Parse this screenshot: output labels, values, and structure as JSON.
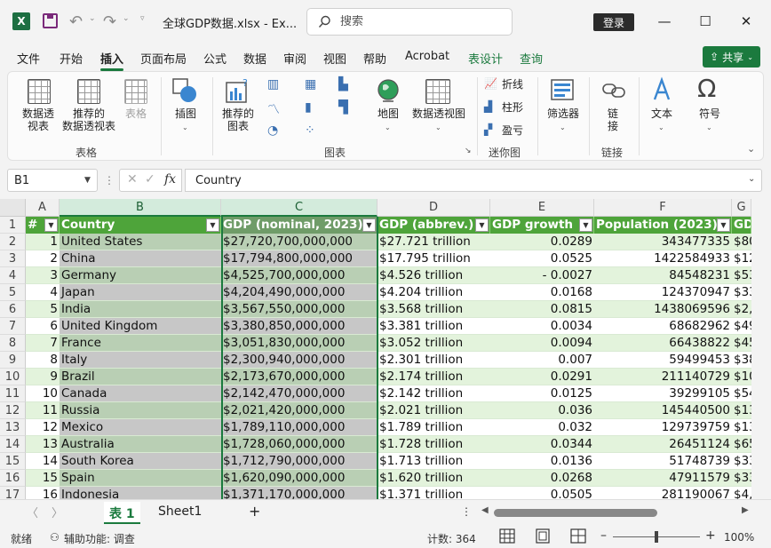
{
  "titlebar": {
    "app_icon": "X",
    "doc_title": "全球GDP数据.xlsx  -  Ex...",
    "search_placeholder": "搜索",
    "login_label": "登录"
  },
  "menu": {
    "tabs": [
      "文件",
      "开始",
      "插入",
      "页面布局",
      "公式",
      "数据",
      "审阅",
      "视图",
      "帮助",
      "Acrobat",
      "表设计",
      "查询"
    ],
    "active_tab": "插入",
    "share_label": "共享"
  },
  "ribbon": {
    "pivot_table": "数据透\n视表",
    "recommended_pivot": "推荐的\n数据透视表",
    "table": "表格",
    "group_tables": "表格",
    "illustrations": "插图",
    "recommended_charts": "推荐的\n图表",
    "group_charts": "图表",
    "map": "地图",
    "pivot_chart": "数据透视图",
    "spark_line": "折线",
    "spark_column": "柱形",
    "spark_winloss": "盈亏",
    "group_sparklines": "迷你图",
    "slicer": "筛选器",
    "link": "链\n接",
    "group_links": "链接",
    "text": "文本",
    "symbol": "符号"
  },
  "formula_bar": {
    "name_box": "B1",
    "formula": "Country"
  },
  "grid": {
    "columns": [
      "A",
      "B",
      "C",
      "D",
      "E",
      "F",
      "G"
    ],
    "header_row": [
      "#",
      "Country",
      "GDP (nominal, 2023)",
      "GDP (abbrev.)",
      "GDP  growth",
      "Population (2023)",
      "GD"
    ],
    "rows": [
      {
        "n": "2",
        "a": "1",
        "b": "United States",
        "c": "$27,720,700,000,000",
        "d": "$27.721 trillion",
        "e": "0.0289",
        "f": "343477335",
        "g": "$80"
      },
      {
        "n": "3",
        "a": "2",
        "b": "China",
        "c": "$17,794,800,000,000",
        "d": "$17.795 trillion",
        "e": "0.0525",
        "f": "1422584933",
        "g": "$12"
      },
      {
        "n": "4",
        "a": "3",
        "b": "Germany",
        "c": "$4,525,700,000,000",
        "d": "$4.526 trillion",
        "e": "- 0.0027",
        "f": "84548231",
        "g": "$53"
      },
      {
        "n": "5",
        "a": "4",
        "b": "Japan",
        "c": "$4,204,490,000,000",
        "d": "$4.204 trillion",
        "e": "0.0168",
        "f": "124370947",
        "g": "$33"
      },
      {
        "n": "6",
        "a": "5",
        "b": "India",
        "c": "$3,567,550,000,000",
        "d": "$3.568 trillion",
        "e": "0.0815",
        "f": "1438069596",
        "g": "$2,"
      },
      {
        "n": "7",
        "a": "6",
        "b": "United Kingdom",
        "c": "$3,380,850,000,000",
        "d": "$3.381 trillion",
        "e": "0.0034",
        "f": "68682962",
        "g": "$49"
      },
      {
        "n": "8",
        "a": "7",
        "b": "France",
        "c": "$3,051,830,000,000",
        "d": "$3.052 trillion",
        "e": "0.0094",
        "f": "66438822",
        "g": "$45"
      },
      {
        "n": "9",
        "a": "8",
        "b": "Italy",
        "c": "$2,300,940,000,000",
        "d": "$2.301 trillion",
        "e": "0.007",
        "f": "59499453",
        "g": "$38"
      },
      {
        "n": "10",
        "a": "9",
        "b": "Brazil",
        "c": "$2,173,670,000,000",
        "d": "$2.174 trillion",
        "e": "0.0291",
        "f": "211140729",
        "g": "$10"
      },
      {
        "n": "11",
        "a": "10",
        "b": "Canada",
        "c": "$2,142,470,000,000",
        "d": "$2.142 trillion",
        "e": "0.0125",
        "f": "39299105",
        "g": "$54"
      },
      {
        "n": "12",
        "a": "11",
        "b": "Russia",
        "c": "$2,021,420,000,000",
        "d": "$2.021 trillion",
        "e": "0.036",
        "f": "145440500",
        "g": "$13"
      },
      {
        "n": "13",
        "a": "12",
        "b": "Mexico",
        "c": "$1,789,110,000,000",
        "d": "$1.789 trillion",
        "e": "0.032",
        "f": "129739759",
        "g": "$13"
      },
      {
        "n": "14",
        "a": "13",
        "b": "Australia",
        "c": "$1,728,060,000,000",
        "d": "$1.728 trillion",
        "e": "0.0344",
        "f": "26451124",
        "g": "$65"
      },
      {
        "n": "15",
        "a": "14",
        "b": "South Korea",
        "c": "$1,712,790,000,000",
        "d": "$1.713 trillion",
        "e": "0.0136",
        "f": "51748739",
        "g": "$33"
      },
      {
        "n": "16",
        "a": "15",
        "b": "Spain",
        "c": "$1,620,090,000,000",
        "d": "$1.620 trillion",
        "e": "0.0268",
        "f": "47911579",
        "g": "$33"
      },
      {
        "n": "17",
        "a": "16",
        "b": "Indonesia",
        "c": "$1,371,170,000,000",
        "d": "$1.371 trillion",
        "e": "0.0505",
        "f": "281190067",
        "g": "$4,"
      }
    ]
  },
  "sheets": {
    "tabs": [
      "表 1",
      "Sheet1"
    ],
    "active": "表 1",
    "add": "+"
  },
  "status": {
    "ready": "就绪",
    "accessibility": "辅助功能: 调查",
    "count": "计数: 364",
    "zoom": "100%"
  },
  "colors": {
    "accent": "#1b7a3e",
    "header_fill": "#4ea43a",
    "band_light": "#e3f3dc",
    "band_white": "#ffffff",
    "selection_fill": "#c7c7c7"
  }
}
